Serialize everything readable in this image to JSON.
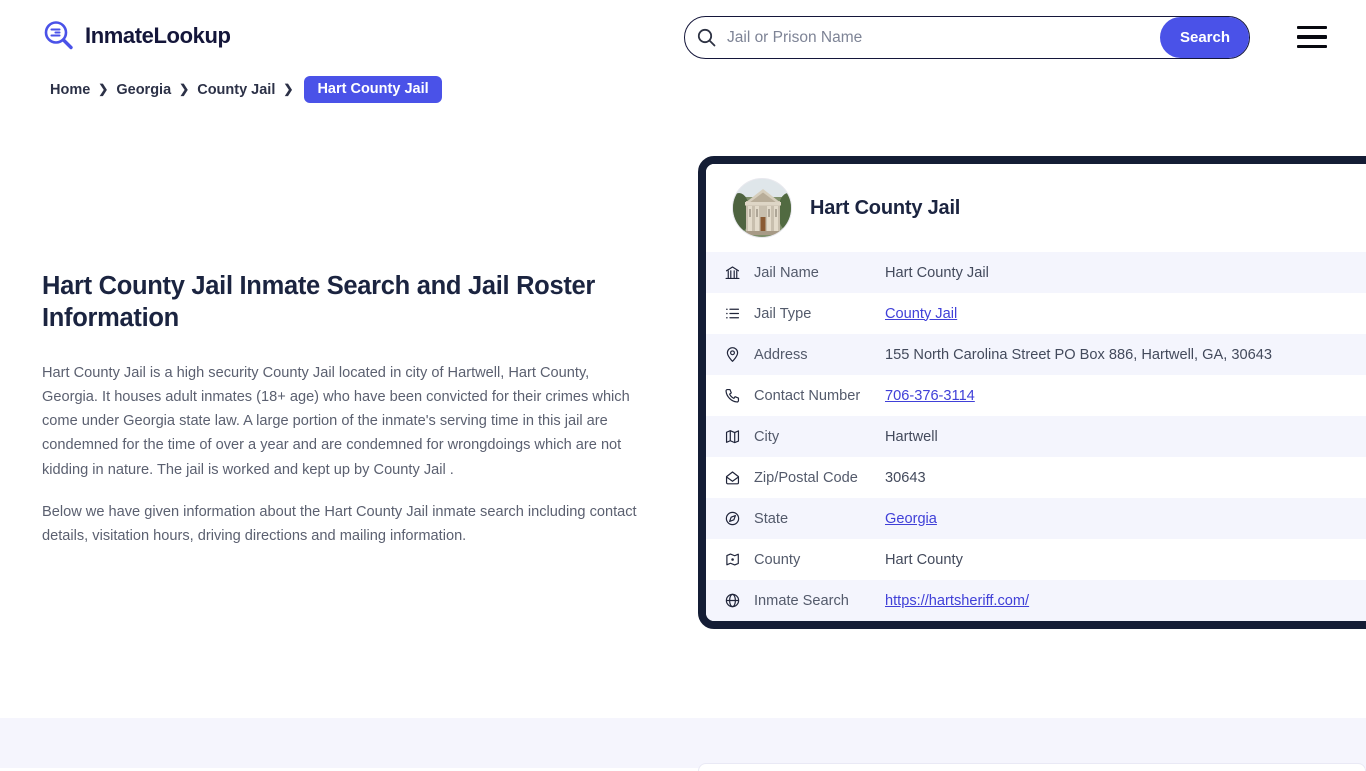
{
  "site": {
    "logo_text": "InmateLookup",
    "logo_icon": "search-magnifier-icon"
  },
  "search": {
    "placeholder": "Jail or Prison Name",
    "value": "",
    "button_label": "Search",
    "icon": "search-icon"
  },
  "menu": {
    "icon": "hamburger-menu-icon"
  },
  "breadcrumb": {
    "items": [
      {
        "label": "Home",
        "active": false
      },
      {
        "label": "Georgia",
        "active": false
      },
      {
        "label": "County Jail",
        "active": false
      },
      {
        "label": "Hart County Jail",
        "active": true
      }
    ],
    "separator": "❯"
  },
  "main": {
    "title": "Hart County Jail Inmate Search and Jail Roster Information",
    "paragraphs": [
      "Hart County Jail is a high security County Jail located in city of Hartwell, Hart County, Georgia. It houses adult inmates (18+ age) who have been convicted for their crimes which come under Georgia state law. A large portion of the inmate's serving time in this jail are condemned for the time of over a year and are condemned for wrongdoings which are not kidding in nature. The jail is worked and kept up by County Jail .",
      "Below we have given information about the Hart County Jail inmate search including contact details, visitation hours, driving directions and mailing information."
    ]
  },
  "detail_card": {
    "avatar_icon": "courthouse-photo",
    "title": "Hart County Jail",
    "rows": [
      {
        "icon": "bank-icon",
        "label": "Jail Name",
        "value": "Hart County Jail",
        "link": false
      },
      {
        "icon": "list-icon",
        "label": "Jail Type",
        "value": "County Jail",
        "link": true
      },
      {
        "icon": "map-pin-icon",
        "label": "Address",
        "value": "155 North Carolina Street PO Box 886, Hartwell, GA, 30643",
        "link": false
      },
      {
        "icon": "phone-icon",
        "label": "Contact Number",
        "value": "706-376-3114",
        "link": true
      },
      {
        "icon": "map-icon",
        "label": "City",
        "value": "Hartwell",
        "link": false
      },
      {
        "icon": "envelope-icon",
        "label": "Zip/Postal Code",
        "value": "30643",
        "link": false
      },
      {
        "icon": "globe-compass-icon",
        "label": "State",
        "value": "Georgia",
        "link": true
      },
      {
        "icon": "map-location-icon",
        "label": "County",
        "value": "Hart County",
        "link": false
      },
      {
        "icon": "globe-icon",
        "label": "Inmate Search",
        "value": "https://hartsheriff.com/",
        "link": true
      }
    ]
  },
  "colors": {
    "accent": "#4a52e8",
    "card_border": "#141d35",
    "row_alt": "#f4f5fd",
    "link": "#4040d8",
    "heading": "#1b2440"
  }
}
